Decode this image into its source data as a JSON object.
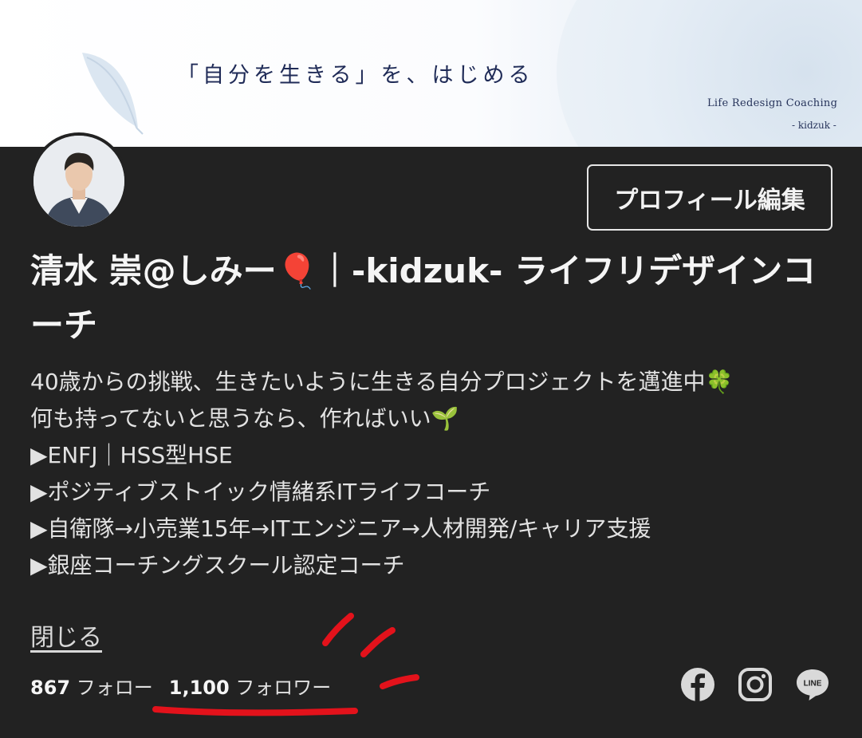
{
  "banner": {
    "tagline": "「自分を生きる」を、はじめる",
    "brand_line1": "Life Redesign Coaching",
    "brand_line2": "- kidzuk -"
  },
  "profile": {
    "edit_button_label": "プロフィール編集",
    "display_name": "清水 崇@しみー🎈｜-kidzuk- ライフリデザインコーチ",
    "bio_lines": [
      "40歳からの挑戦、生きたいように生きる自分プロジェクトを邁進中🍀",
      "何も持ってないと思うなら、作ればいい🌱",
      "▶ENFJ｜HSS型HSE",
      "▶ポジティブストイック情緒系ITライフコーチ",
      "▶自衛隊→小売業15年→ITエンジニア→人材開発/キャリア支援",
      "▶銀座コーチングスクール認定コーチ"
    ],
    "close_label": "閉じる"
  },
  "stats": {
    "following_count": "867",
    "following_label": "フォロー",
    "followers_count": "1,100",
    "followers_label": "フォロワー"
  },
  "social_icons": [
    "facebook-icon",
    "instagram-icon",
    "line-icon"
  ],
  "line_icon_text": "LINE",
  "colors": {
    "background": "#222222",
    "text": "#f2f2f2",
    "annotation_red": "#e3121b",
    "banner_navy": "#1f2b57"
  }
}
